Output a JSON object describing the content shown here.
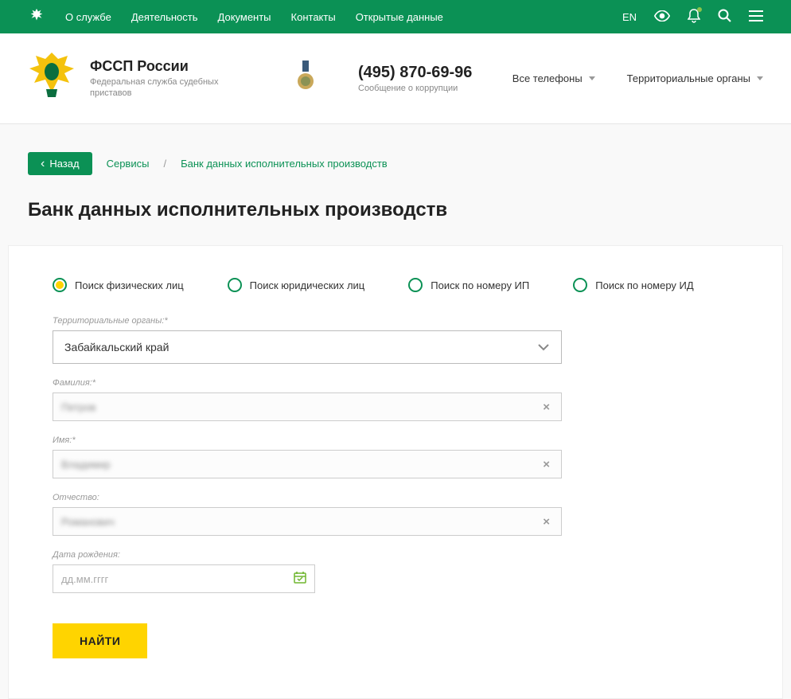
{
  "topnav": {
    "items": [
      "О службе",
      "Деятельность",
      "Документы",
      "Контакты",
      "Открытые данные"
    ],
    "lang": "EN"
  },
  "header": {
    "title": "ФССП России",
    "subtitle": "Федеральная служба судебных приставов",
    "phone": "(495) 870-69-96",
    "phone_sub": "Сообщение о коррупции",
    "dropdown_phones": "Все телефоны",
    "dropdown_regions": "Территориальные органы"
  },
  "crumbs": {
    "back": "Назад",
    "services": "Сервисы",
    "current": "Банк данных исполнительных производств"
  },
  "page_title": "Банк данных исполнительных производств",
  "radios": {
    "r0": "Поиск физических лиц",
    "r1": "Поиск юридических лиц",
    "r2": "Поиск по номеру ИП",
    "r3": "Поиск по номеру ИД"
  },
  "form": {
    "region_label": "Территориальные органы:*",
    "region_value": "Забайкальский край",
    "surname_label": "Фамилия:*",
    "surname_value": "Петров",
    "name_label": "Имя:*",
    "name_value": "Владимир",
    "patronymic_label": "Отчество:",
    "patronymic_value": "Романович",
    "dob_label": "Дата рождения:",
    "dob_placeholder": "дд.мм.гггг",
    "submit": "НАЙТИ"
  }
}
